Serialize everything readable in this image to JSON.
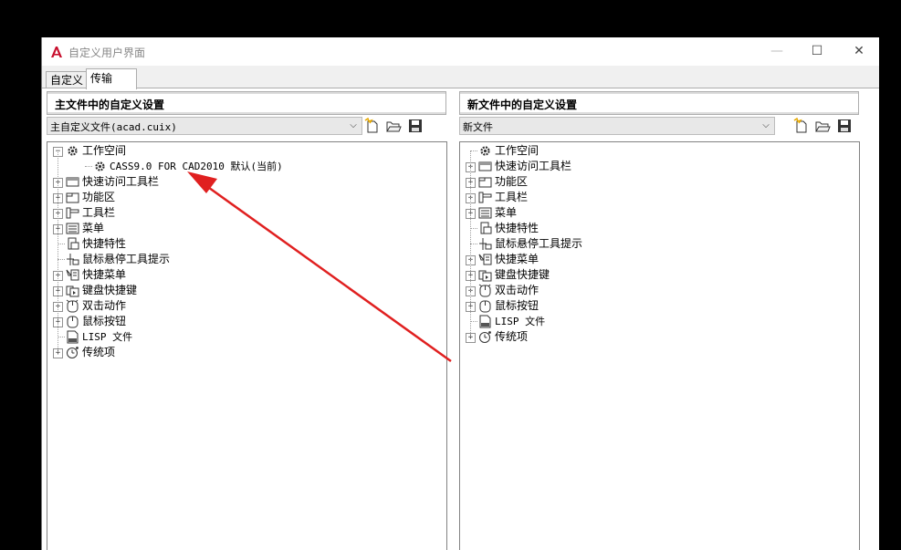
{
  "window": {
    "title": "自定义用户界面",
    "minimize": "—",
    "maximize": "☐",
    "close": "✕"
  },
  "tabs": [
    {
      "label": "自定义",
      "active": false
    },
    {
      "label": "传输",
      "active": true
    }
  ],
  "left_panel": {
    "header": "主文件中的自定义设置",
    "combo_value": "主自定义文件(acad.cuix)",
    "tree": [
      {
        "label": "工作空间",
        "icon": "gear-icon",
        "expander": "⊟"
      },
      {
        "label": "CASS9.0 FOR CAD2010 默认(当前)",
        "icon": "gear-icon",
        "child": true
      },
      {
        "label": "快速访问工具栏",
        "icon": "quick-access-toolbar-icon",
        "expander": "⊞"
      },
      {
        "label": "功能区",
        "icon": "ribbon-icon",
        "expander": "⊞"
      },
      {
        "label": "工具栏",
        "icon": "toolbar-icon",
        "expander": "⊞"
      },
      {
        "label": "菜单",
        "icon": "menu-icon",
        "expander": "⊞"
      },
      {
        "label": "快捷特性",
        "icon": "quick-properties-icon"
      },
      {
        "label": "鼠标悬停工具提示",
        "icon": "rollover-tooltip-icon"
      },
      {
        "label": "快捷菜单",
        "icon": "shortcut-menu-icon",
        "expander": "⊞"
      },
      {
        "label": "键盘快捷键",
        "icon": "keyboard-shortcut-icon",
        "expander": "⊞"
      },
      {
        "label": "双击动作",
        "icon": "double-click-icon",
        "expander": "⊞"
      },
      {
        "label": "鼠标按钮",
        "icon": "mouse-button-icon",
        "expander": "⊞"
      },
      {
        "label": "LISP 文件",
        "icon": "lisp-file-icon"
      },
      {
        "label": "传统项",
        "icon": "legacy-icon",
        "expander": "⊞"
      }
    ]
  },
  "right_panel": {
    "header": "新文件中的自定义设置",
    "combo_value": "新文件",
    "tree": [
      {
        "label": "工作空间",
        "icon": "gear-icon"
      },
      {
        "label": "快速访问工具栏",
        "icon": "quick-access-toolbar-icon",
        "expander": "⊞"
      },
      {
        "label": "功能区",
        "icon": "ribbon-icon",
        "expander": "⊞"
      },
      {
        "label": "工具栏",
        "icon": "toolbar-icon",
        "expander": "⊞"
      },
      {
        "label": "菜单",
        "icon": "menu-icon",
        "expander": "⊞"
      },
      {
        "label": "快捷特性",
        "icon": "quick-properties-icon"
      },
      {
        "label": "鼠标悬停工具提示",
        "icon": "rollover-tooltip-icon"
      },
      {
        "label": "快捷菜单",
        "icon": "shortcut-menu-icon",
        "expander": "⊞"
      },
      {
        "label": "键盘快捷键",
        "icon": "keyboard-shortcut-icon",
        "expander": "⊞"
      },
      {
        "label": "双击动作",
        "icon": "double-click-icon",
        "expander": "⊞"
      },
      {
        "label": "鼠标按钮",
        "icon": "mouse-button-icon",
        "expander": "⊞"
      },
      {
        "label": "LISP 文件",
        "icon": "lisp-file-icon"
      },
      {
        "label": "传统项",
        "icon": "legacy-icon",
        "expander": "⊞"
      }
    ]
  },
  "colors": {
    "annotation_arrow": "#e02020",
    "background": "#000000"
  }
}
